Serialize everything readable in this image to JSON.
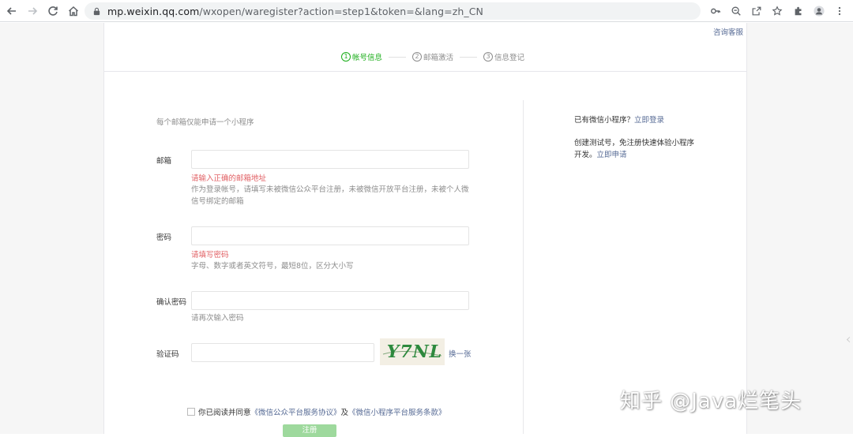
{
  "browser": {
    "url_host": "mp.weixin.qq.com",
    "url_path": "/wxopen/waregister?action=step1&token=&lang=zh_CN"
  },
  "header": {
    "help_link": "咨询客服",
    "steps": [
      {
        "num": "1",
        "label": "帐号信息",
        "active": true
      },
      {
        "num": "2",
        "label": "邮箱激活",
        "active": false
      },
      {
        "num": "3",
        "label": "信息登记",
        "active": false
      }
    ]
  },
  "form": {
    "tip": "每个邮箱仅能申请一个小程序",
    "email": {
      "label": "邮箱",
      "value": "",
      "error": "请输入正确的邮箱地址",
      "hint": "作为登录帐号，请填写未被微信公众平台注册，未被微信开放平台注册，未被个人微信号绑定的邮箱"
    },
    "password": {
      "label": "密码",
      "value": "",
      "error": "请填写密码",
      "hint": "字母、数字或者英文符号，最短8位，区分大小写"
    },
    "confirm": {
      "label": "确认密码",
      "value": "",
      "hint": "请再次输入密码"
    },
    "captcha": {
      "label": "验证码",
      "value": "",
      "image_text": "Y7NL",
      "refresh": "换一张"
    },
    "agree": {
      "prefix": "你已阅读并同意",
      "link1": "《微信公众平台服务协议》",
      "middle": "及",
      "link2": "《微信小程序平台服务条款》"
    },
    "submit_label": "注册"
  },
  "sidebar": {
    "line1_text": "已有微信小程序？",
    "line1_link": "立即登录",
    "line2_text": "创建测试号，免注册快速体验小程序开发。",
    "line2_link": "立即申请"
  },
  "watermark": "知乎 @Java烂笔头",
  "colors": {
    "accent_green": "#1aad19",
    "link_blue": "#576b95",
    "error_red": "#e15f63"
  }
}
